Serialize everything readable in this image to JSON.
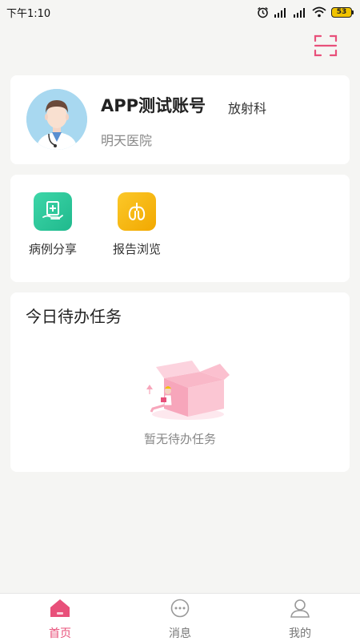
{
  "status_bar": {
    "time": "下午1:10",
    "battery": "53"
  },
  "profile": {
    "account_name": "APP测试账号",
    "department": "放射科",
    "hospital": "明天医院"
  },
  "quick_actions": [
    {
      "label": "病例分享",
      "icon": "case-share-icon",
      "color": "#2ec79b"
    },
    {
      "label": "报告浏览",
      "icon": "report-browse-icon",
      "color": "#f7b500"
    }
  ],
  "tasks": {
    "title": "今日待办任务",
    "empty_text": "暂无待办任务"
  },
  "tab_bar": {
    "items": [
      {
        "label": "首页",
        "icon": "home-icon",
        "active": true
      },
      {
        "label": "消息",
        "icon": "message-icon",
        "active": false
      },
      {
        "label": "我的",
        "icon": "profile-icon",
        "active": false
      }
    ]
  },
  "colors": {
    "accent": "#e8507a",
    "background": "#f5f5f3"
  }
}
